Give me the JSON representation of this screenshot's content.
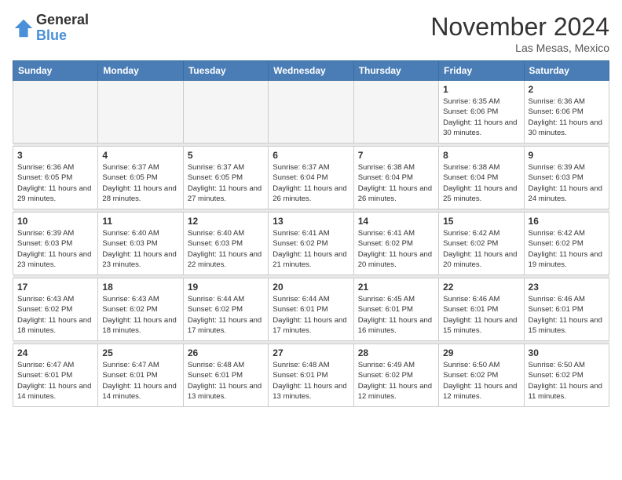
{
  "logo": {
    "general": "General",
    "blue": "Blue"
  },
  "title": "November 2024",
  "location": "Las Mesas, Mexico",
  "weekdays": [
    "Sunday",
    "Monday",
    "Tuesday",
    "Wednesday",
    "Thursday",
    "Friday",
    "Saturday"
  ],
  "weeks": [
    [
      {
        "day": "",
        "info": ""
      },
      {
        "day": "",
        "info": ""
      },
      {
        "day": "",
        "info": ""
      },
      {
        "day": "",
        "info": ""
      },
      {
        "day": "",
        "info": ""
      },
      {
        "day": "1",
        "info": "Sunrise: 6:35 AM\nSunset: 6:06 PM\nDaylight: 11 hours and 30 minutes."
      },
      {
        "day": "2",
        "info": "Sunrise: 6:36 AM\nSunset: 6:06 PM\nDaylight: 11 hours and 30 minutes."
      }
    ],
    [
      {
        "day": "3",
        "info": "Sunrise: 6:36 AM\nSunset: 6:05 PM\nDaylight: 11 hours and 29 minutes."
      },
      {
        "day": "4",
        "info": "Sunrise: 6:37 AM\nSunset: 6:05 PM\nDaylight: 11 hours and 28 minutes."
      },
      {
        "day": "5",
        "info": "Sunrise: 6:37 AM\nSunset: 6:05 PM\nDaylight: 11 hours and 27 minutes."
      },
      {
        "day": "6",
        "info": "Sunrise: 6:37 AM\nSunset: 6:04 PM\nDaylight: 11 hours and 26 minutes."
      },
      {
        "day": "7",
        "info": "Sunrise: 6:38 AM\nSunset: 6:04 PM\nDaylight: 11 hours and 26 minutes."
      },
      {
        "day": "8",
        "info": "Sunrise: 6:38 AM\nSunset: 6:04 PM\nDaylight: 11 hours and 25 minutes."
      },
      {
        "day": "9",
        "info": "Sunrise: 6:39 AM\nSunset: 6:03 PM\nDaylight: 11 hours and 24 minutes."
      }
    ],
    [
      {
        "day": "10",
        "info": "Sunrise: 6:39 AM\nSunset: 6:03 PM\nDaylight: 11 hours and 23 minutes."
      },
      {
        "day": "11",
        "info": "Sunrise: 6:40 AM\nSunset: 6:03 PM\nDaylight: 11 hours and 23 minutes."
      },
      {
        "day": "12",
        "info": "Sunrise: 6:40 AM\nSunset: 6:03 PM\nDaylight: 11 hours and 22 minutes."
      },
      {
        "day": "13",
        "info": "Sunrise: 6:41 AM\nSunset: 6:02 PM\nDaylight: 11 hours and 21 minutes."
      },
      {
        "day": "14",
        "info": "Sunrise: 6:41 AM\nSunset: 6:02 PM\nDaylight: 11 hours and 20 minutes."
      },
      {
        "day": "15",
        "info": "Sunrise: 6:42 AM\nSunset: 6:02 PM\nDaylight: 11 hours and 20 minutes."
      },
      {
        "day": "16",
        "info": "Sunrise: 6:42 AM\nSunset: 6:02 PM\nDaylight: 11 hours and 19 minutes."
      }
    ],
    [
      {
        "day": "17",
        "info": "Sunrise: 6:43 AM\nSunset: 6:02 PM\nDaylight: 11 hours and 18 minutes."
      },
      {
        "day": "18",
        "info": "Sunrise: 6:43 AM\nSunset: 6:02 PM\nDaylight: 11 hours and 18 minutes."
      },
      {
        "day": "19",
        "info": "Sunrise: 6:44 AM\nSunset: 6:02 PM\nDaylight: 11 hours and 17 minutes."
      },
      {
        "day": "20",
        "info": "Sunrise: 6:44 AM\nSunset: 6:01 PM\nDaylight: 11 hours and 17 minutes."
      },
      {
        "day": "21",
        "info": "Sunrise: 6:45 AM\nSunset: 6:01 PM\nDaylight: 11 hours and 16 minutes."
      },
      {
        "day": "22",
        "info": "Sunrise: 6:46 AM\nSunset: 6:01 PM\nDaylight: 11 hours and 15 minutes."
      },
      {
        "day": "23",
        "info": "Sunrise: 6:46 AM\nSunset: 6:01 PM\nDaylight: 11 hours and 15 minutes."
      }
    ],
    [
      {
        "day": "24",
        "info": "Sunrise: 6:47 AM\nSunset: 6:01 PM\nDaylight: 11 hours and 14 minutes."
      },
      {
        "day": "25",
        "info": "Sunrise: 6:47 AM\nSunset: 6:01 PM\nDaylight: 11 hours and 14 minutes."
      },
      {
        "day": "26",
        "info": "Sunrise: 6:48 AM\nSunset: 6:01 PM\nDaylight: 11 hours and 13 minutes."
      },
      {
        "day": "27",
        "info": "Sunrise: 6:48 AM\nSunset: 6:01 PM\nDaylight: 11 hours and 13 minutes."
      },
      {
        "day": "28",
        "info": "Sunrise: 6:49 AM\nSunset: 6:02 PM\nDaylight: 11 hours and 12 minutes."
      },
      {
        "day": "29",
        "info": "Sunrise: 6:50 AM\nSunset: 6:02 PM\nDaylight: 11 hours and 12 minutes."
      },
      {
        "day": "30",
        "info": "Sunrise: 6:50 AM\nSunset: 6:02 PM\nDaylight: 11 hours and 11 minutes."
      }
    ]
  ]
}
